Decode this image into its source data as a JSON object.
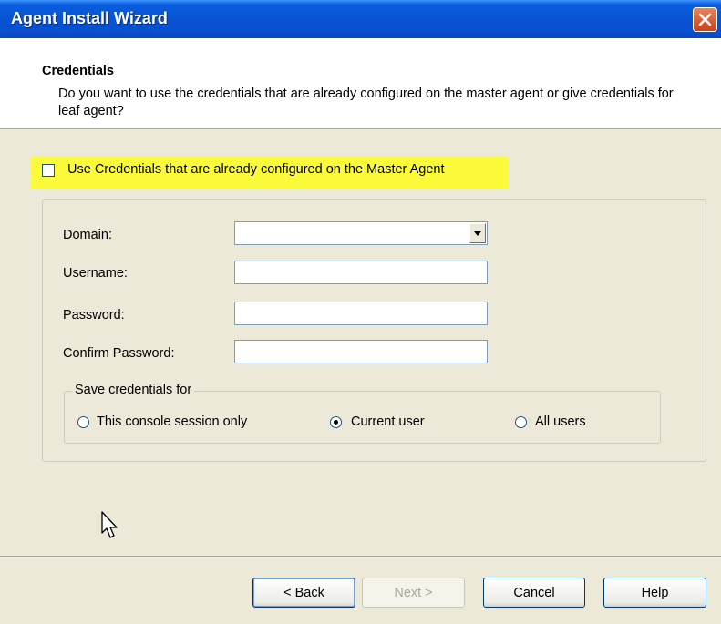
{
  "window": {
    "title": "Agent Install Wizard"
  },
  "header": {
    "title": "Credentials",
    "subtitle": "Do you want to use the credentials that are already configured on the master agent or give credentials for leaf agent?"
  },
  "use_master_credentials": {
    "label": "Use Credentials that are already configured on the Master Agent",
    "checked": false,
    "highlight_color": "#fbfb3c"
  },
  "form": {
    "domain": {
      "label": "Domain:",
      "value": ""
    },
    "username": {
      "label": "Username:",
      "value": ""
    },
    "password": {
      "label": "Password:",
      "value": ""
    },
    "confirm_password": {
      "label": "Confirm Password:",
      "value": ""
    }
  },
  "save_for": {
    "legend": "Save credentials for",
    "options": [
      {
        "label": "This console session only",
        "selected": false
      },
      {
        "label": "Current user",
        "selected": true
      },
      {
        "label": "All users",
        "selected": false
      }
    ]
  },
  "buttons": {
    "back": "< Back",
    "next": "Next >",
    "cancel": "Cancel",
    "help": "Help"
  },
  "colors": {
    "titlebar": "#0852d4",
    "dialog_bg": "#ece9d8",
    "close_button": "#d4582f"
  }
}
